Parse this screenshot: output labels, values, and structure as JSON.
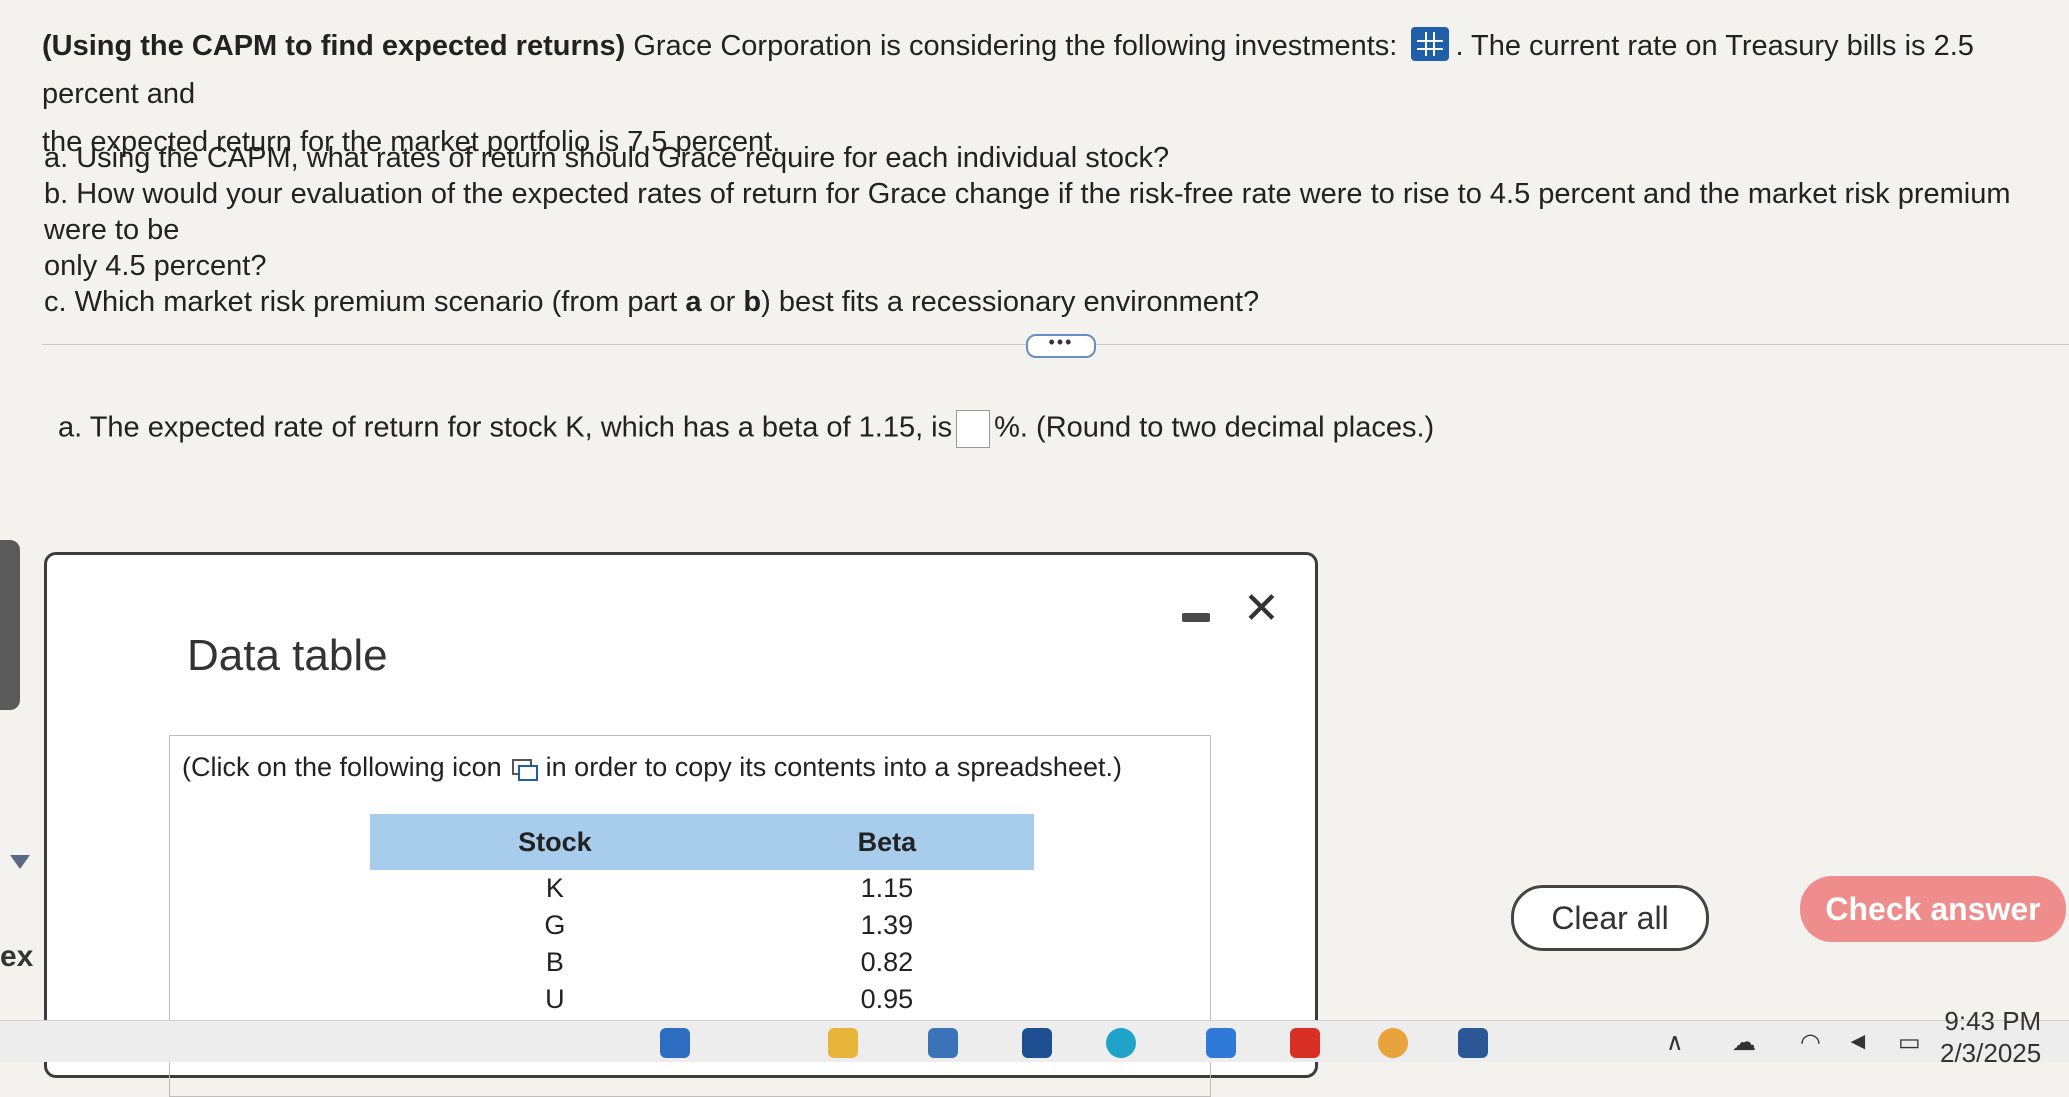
{
  "question": {
    "title": "(Using the CAPM to find expected returns)",
    "intro_1": "Grace Corporation is considering the following investments:",
    "intro_2": ". The current rate on Treasury bills is 2.5 percent and",
    "intro_3": "the expected return for the market portfolio is 7.5 percent.",
    "part_a": "a. Using the CAPM, what rates of return should Grace require for each individual stock?",
    "part_b_1": "b. How would your evaluation of the expected rates of return for Grace change if the risk-free rate were to rise to 4.5 percent and the market risk premium were to be",
    "part_b_2": "only 4.5 percent?",
    "part_c_pre": "c. Which market risk premium scenario (from part ",
    "part_c_a": "a",
    "part_c_mid": " or ",
    "part_c_b": "b",
    "part_c_post": ") best fits a recessionary environment?"
  },
  "more_button": "•••",
  "answer": {
    "prefix": "a. The expected rate of return for stock K, which has a beta of 1.15, is",
    "suffix": "%.  (Round to two decimal places.)",
    "value": ""
  },
  "dialog": {
    "title": "Data table",
    "close": "✕",
    "copy_pre": "(Click on the following icon",
    "copy_post": "in order to copy its contents into a spreadsheet.)",
    "table": {
      "headers": [
        "Stock",
        "Beta"
      ],
      "rows": [
        [
          "K",
          "1.15"
        ],
        [
          "G",
          "1.39"
        ],
        [
          "B",
          "0.82"
        ],
        [
          "U",
          "0.95"
        ]
      ]
    }
  },
  "buttons": {
    "clear_all": "Clear all",
    "check_answer": "Check answer"
  },
  "left_text": "ex",
  "system": {
    "time": "9:43 PM",
    "date": "2/3/2025"
  },
  "colors": {
    "accent": "#1f5fa8",
    "table_header": "#a8cceb",
    "check_answer": "#ef8d8d"
  }
}
